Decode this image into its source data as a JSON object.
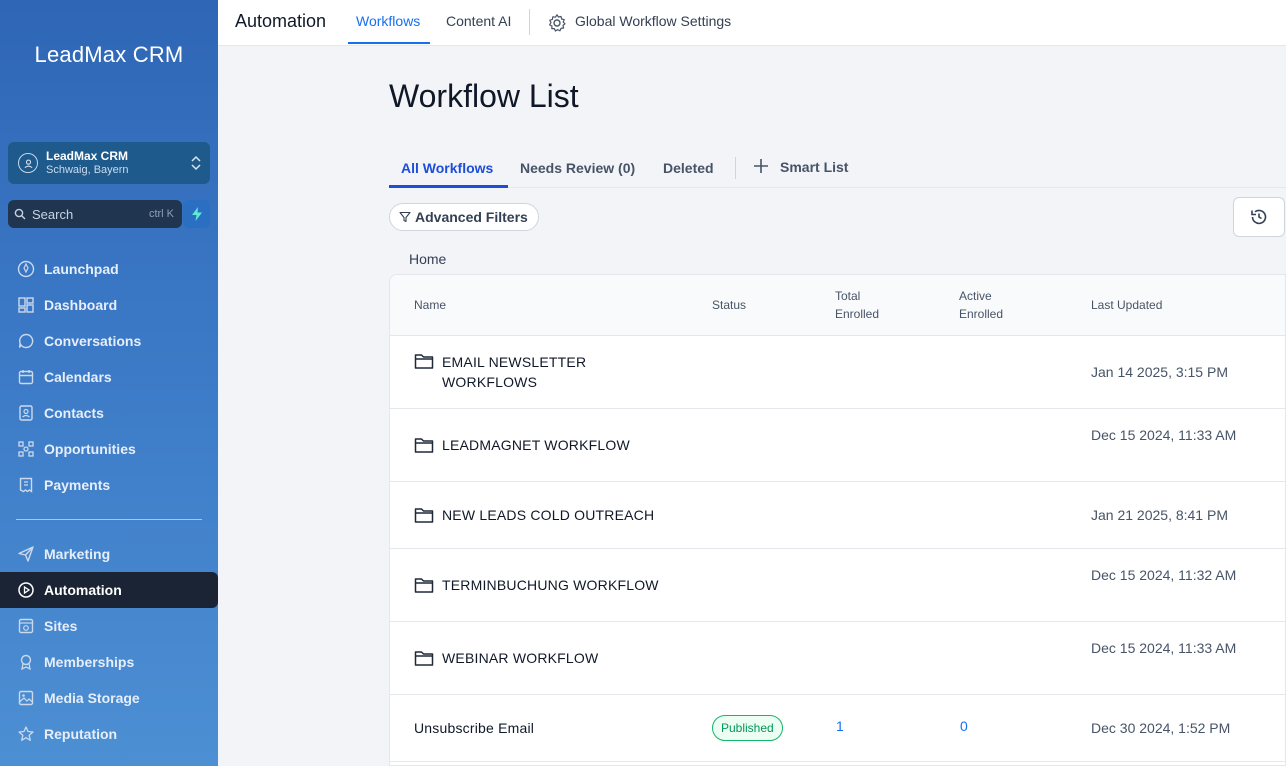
{
  "sidebar": {
    "brand": "LeadMax CRM",
    "account": {
      "name": "LeadMax CRM",
      "location": "Schwaig, Bayern"
    },
    "search": {
      "placeholder": "Search",
      "shortcut": "ctrl K"
    },
    "items": [
      {
        "label": "Launchpad",
        "icon": "rocket-icon"
      },
      {
        "label": "Dashboard",
        "icon": "grid-icon"
      },
      {
        "label": "Conversations",
        "icon": "chat-icon"
      },
      {
        "label": "Calendars",
        "icon": "calendar-icon"
      },
      {
        "label": "Contacts",
        "icon": "contacts-icon"
      },
      {
        "label": "Opportunities",
        "icon": "opportunities-icon"
      },
      {
        "label": "Payments",
        "icon": "payments-icon"
      },
      {
        "label": "Marketing",
        "icon": "send-icon"
      },
      {
        "label": "Automation",
        "icon": "automation-icon",
        "active": true
      },
      {
        "label": "Sites",
        "icon": "sites-icon"
      },
      {
        "label": "Memberships",
        "icon": "memberships-icon"
      },
      {
        "label": "Media Storage",
        "icon": "image-icon"
      },
      {
        "label": "Reputation",
        "icon": "star-icon"
      }
    ]
  },
  "topbar": {
    "title": "Automation",
    "tabs": [
      "Workflows",
      "Content AI"
    ],
    "settings_label": "Global Workflow Settings"
  },
  "page": {
    "title": "Workflow List",
    "subtabs": [
      "All Workflows",
      "Needs Review (0)",
      "Deleted"
    ],
    "smart_list_label": "Smart List",
    "filters_label": "Advanced Filters",
    "breadcrumb": "Home"
  },
  "table": {
    "headers": {
      "name": "Name",
      "status": "Status",
      "total_1": "Total",
      "total_2": "Enrolled",
      "active_1": "Active",
      "active_2": "Enrolled",
      "updated": "Last Updated"
    },
    "rows": [
      {
        "name": "EMAIL NEWSLETTER WORKFLOWS",
        "updated": "Jan 14 2025, 3:15 PM",
        "folder": true
      },
      {
        "name": "LEADMAGNET WORKFLOW",
        "updated": "Dec 15 2024, 11:33 AM",
        "folder": true
      },
      {
        "name": "NEW LEADS COLD OUTREACH",
        "updated": "Jan 21 2025, 8:41 PM",
        "folder": true
      },
      {
        "name": "TERMINBUCHUNG WORKFLOW",
        "updated": "Dec 15 2024, 11:32 AM",
        "folder": true
      },
      {
        "name": "WEBINAR WORKFLOW",
        "updated": "Dec 15 2024, 11:33 AM",
        "folder": true
      },
      {
        "name": "Unsubscribe Email",
        "status": "Published",
        "total": "1",
        "active": "0",
        "updated": "Dec 30 2024, 1:52 PM",
        "folder": false
      }
    ]
  }
}
